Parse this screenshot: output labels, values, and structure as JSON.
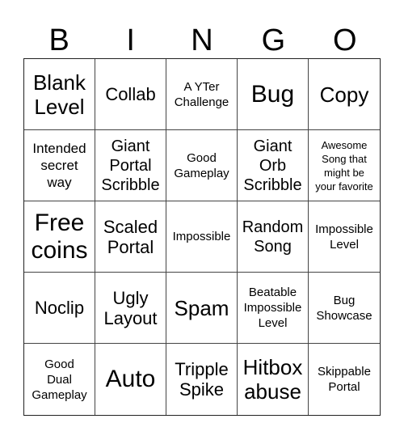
{
  "header": {
    "letters": [
      "B",
      "I",
      "N",
      "G",
      "O"
    ]
  },
  "cells": [
    {
      "text": "Blank\nLevel",
      "size": "lg"
    },
    {
      "text": "Collab",
      "size": "ml"
    },
    {
      "text": "A YTer\nChallenge",
      "size": "xs"
    },
    {
      "text": "Bug",
      "size": "xl"
    },
    {
      "text": "Copy",
      "size": "lg"
    },
    {
      "text": "Intended\nsecret\nway",
      "size": "sm"
    },
    {
      "text": "Giant\nPortal\nScribble",
      "size": "md"
    },
    {
      "text": "Good\nGameplay",
      "size": "xs"
    },
    {
      "text": "Giant\nOrb\nScribble",
      "size": "md"
    },
    {
      "text": "Awesome\nSong that\nmight be\nyour favorite",
      "size": "xxs"
    },
    {
      "text": "Free\ncoins",
      "size": "xl"
    },
    {
      "text": "Scaled\nPortal",
      "size": "ml"
    },
    {
      "text": "Impossible",
      "size": "xs"
    },
    {
      "text": "Random\nSong",
      "size": "md"
    },
    {
      "text": "Impossible\nLevel",
      "size": "xs"
    },
    {
      "text": "Noclip",
      "size": "ml"
    },
    {
      "text": "Ugly\nLayout",
      "size": "ml"
    },
    {
      "text": "Spam",
      "size": "lg"
    },
    {
      "text": "Beatable\nImpossible\nLevel",
      "size": "xs"
    },
    {
      "text": "Bug\nShowcase",
      "size": "xs"
    },
    {
      "text": "Good\nDual\nGameplay",
      "size": "xs"
    },
    {
      "text": "Auto",
      "size": "xl"
    },
    {
      "text": "Tripple\nSpike",
      "size": "ml"
    },
    {
      "text": "Hitbox\nabuse",
      "size": "lg"
    },
    {
      "text": "Skippable\nPortal",
      "size": "xs"
    }
  ]
}
